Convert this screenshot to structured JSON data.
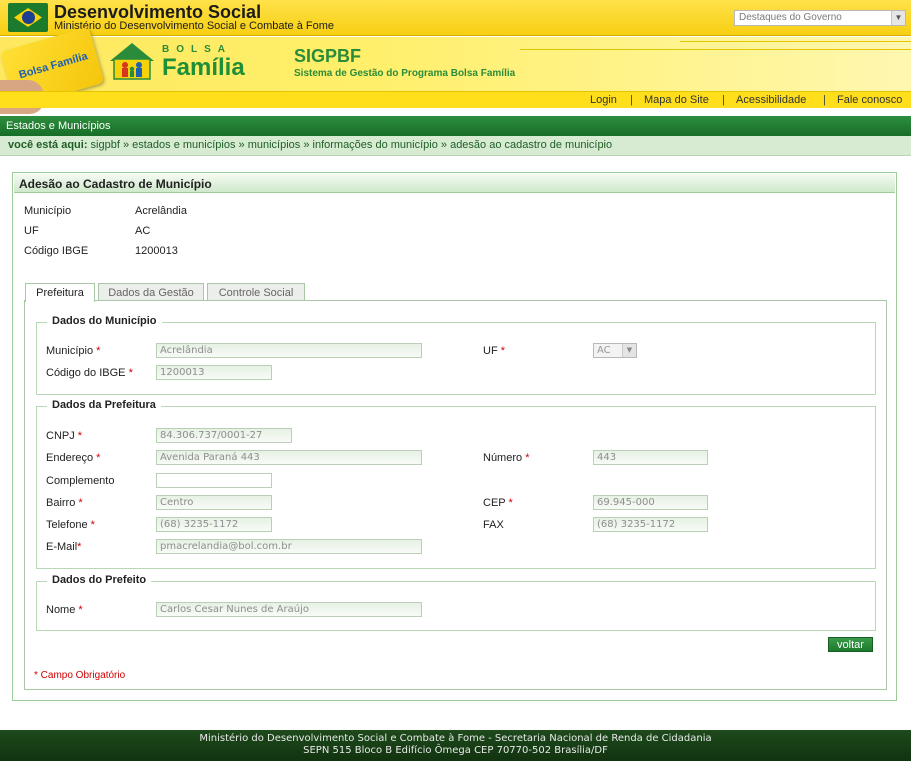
{
  "gov_bar": {
    "title": "Desenvolvimento Social",
    "subtitle": "Ministério do Desenvolvimento Social e Combate à Fome",
    "select_value": "Destaques do Governo"
  },
  "banner": {
    "card_text": "Bolsa Família",
    "bolsa": "BOLSA",
    "familia": "Família",
    "system_title": "SIGPBF",
    "system_subtitle": "Sistema de Gestão do Programa Bolsa Família"
  },
  "links": {
    "login": "Login",
    "mapa": "Mapa do Site",
    "acessibilidade": "Acessibilidade",
    "fale": "Fale conosco",
    "separator": "|"
  },
  "section": {
    "title": "Estados e Municípios"
  },
  "breadcrumb": {
    "label": "você está aqui:",
    "path": "sigpbf » estados e municípios » municípios » informações do município » adesão ao cadastro de município"
  },
  "panel": {
    "title": "Adesão ao Cadastro de Município",
    "info": {
      "municipio_label": "Município",
      "municipio_value": "Acrelândia",
      "uf_label": "UF",
      "uf_value": "AC",
      "ibge_label": "Código IBGE",
      "ibge_value": "1200013"
    }
  },
  "tabs": {
    "prefeitura": "Prefeitura",
    "gestao": "Dados da Gestão",
    "controle": "Controle Social"
  },
  "form": {
    "required_mark": "*",
    "municipio_group": {
      "legend": "Dados do Município",
      "municipio_label": "Município",
      "municipio_value": "Acrelândia",
      "uf_label": "UF",
      "uf_value": "AC",
      "ibge_label": "Código do IBGE",
      "ibge_value": "1200013"
    },
    "prefeitura_group": {
      "legend": "Dados da Prefeitura",
      "cnpj_label": "CNPJ",
      "cnpj_value": "84.306.737/0001-27",
      "endereco_label": "Endereço",
      "endereco_value": "Avenida Paraná 443",
      "numero_label": "Número",
      "numero_value": "443",
      "complemento_label": "Complemento",
      "complemento_value": "",
      "bairro_label": "Bairro",
      "bairro_value": "Centro",
      "cep_label": "CEP",
      "cep_value": "69.945-000",
      "telefone_label": "Telefone",
      "telefone_value": "(68) 3235-1172",
      "fax_label": "FAX",
      "fax_value": "(68) 3235-1172",
      "email_label": "E-Mail",
      "email_value": "pmacrelandia@bol.com.br"
    },
    "prefeito_group": {
      "legend": "Dados do Prefeito",
      "nome_label": "Nome",
      "nome_value": "Carlos Cesar Nunes de Araújo"
    },
    "voltar": "voltar",
    "required_note": "* Campo Obrigatório"
  },
  "footer": {
    "line1": "Ministério do Desenvolvimento Social e Combate à Fome - Secretaria Nacional de Renda de Cidadania",
    "line2": "SEPN 515 Bloco B Edifício Ômega CEP 70770-502 Brasília/DF"
  }
}
